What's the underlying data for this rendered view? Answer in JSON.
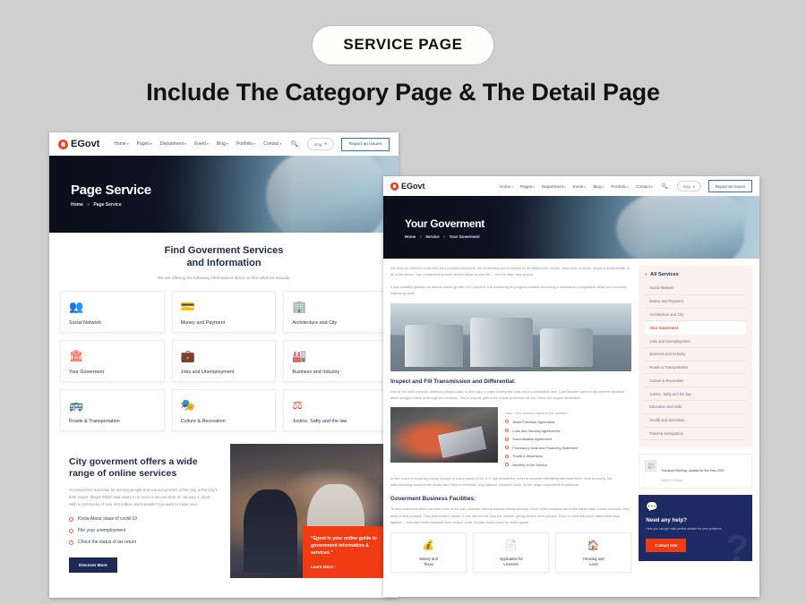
{
  "badge": {
    "label": "SERVICE PAGE"
  },
  "headline": {
    "text": "Include The Category Page &  The Detail Page"
  },
  "colors": {
    "accent": "#ef4123",
    "navy": "#1d2a63",
    "orange": "#f13b12"
  },
  "site": {
    "brand": "EGovt",
    "nav": [
      {
        "label": "Home"
      },
      {
        "label": "Pages"
      },
      {
        "label": "Department"
      },
      {
        "label": "Event"
      },
      {
        "label": "Blog"
      },
      {
        "label": "Portfolio"
      },
      {
        "label": "Contact"
      }
    ],
    "caret": "▾",
    "search_icon": "search-icon",
    "language": "Eng",
    "report_button": "Report an Issues"
  },
  "page1": {
    "hero": {
      "title": "Page Service",
      "crumb_home": "Home",
      "crumb_current": "Page Service"
    },
    "section": {
      "title_line1": "Find Goverment Services",
      "title_line2": "and Information",
      "subtitle": "We are offering the following informations about us that what we actually."
    },
    "services": [
      {
        "label": "Social Network",
        "icon": "users-icon",
        "glyph": "👥"
      },
      {
        "label": "Money and Payment",
        "icon": "card-icon",
        "glyph": "💳"
      },
      {
        "label": "Architecture and City",
        "icon": "buildings-icon",
        "glyph": "🏢"
      },
      {
        "label": "Your Goverment",
        "icon": "bank-icon",
        "glyph": "🏛"
      },
      {
        "label": "Jobs and Unemployment",
        "icon": "briefcase-icon",
        "glyph": "💼"
      },
      {
        "label": "Business and Industry",
        "icon": "factory-icon",
        "glyph": "🏭"
      },
      {
        "label": "Roads & Transportation",
        "icon": "bus-icon",
        "glyph": "🚌"
      },
      {
        "label": "Culture & Recreation",
        "icon": "culture-icon",
        "glyph": "🎭"
      },
      {
        "label": "Justice, Safty and the law",
        "icon": "scales-icon",
        "glyph": "⚖"
      }
    ],
    "promo": {
      "heading": "City goverment offers a wide range of online services",
      "paragraph": "Accomplished advocate for working people and a proud product of the City, is the City's 54th mayor. Mayor Walsh was sworn in to serve a second term on January 1, 2018. With a community of over 400 million users wouldn't you want to make sure.",
      "bullets": [
        "Know About staus of covid-19",
        "File your unemployment",
        "Check the status of tax return"
      ],
      "button": "Discover More",
      "callout_quote": "“Egovt is your online guide to government information & services.”",
      "callout_link": "Learn More ›"
    }
  },
  "page2": {
    "hero": {
      "title": "Your Goverment",
      "crumb_home": "Home",
      "crumb_mid": "Service",
      "crumb_current": "Your Goverment"
    },
    "intro_p1": "We help our clients to build their best possible economic. We understand you're saving for all different life events: retirement, a house, simply to build wealth, or all of the above. Your investment account should adjust to your life — not the other way around.",
    "intro_p2": "It was installed globally, an annual market growth of 12 percent. It is continuing its progress towards becoming a mainstream competitive salary and economy experts by Intra.",
    "section1_heading": "Inspect and Fill Transmission and Differential:",
    "section1_paragraph": "One of the most common additions people make to their cars in order to keep the heat out is a windshield visor. Cars become warm in the summer because direct sunlight enters in through the windows. This is why we park in the shade whenever we can. Since the largest windshield.",
    "bullets_intro": "visor. Cars become warm in the summer",
    "bullets": [
      "Asset Purchase Agreement",
      "Loan and Security Agreements",
      "Subordination Agreement",
      "Promissory Note and Financing Statement",
      "Trustd & Attachions",
      "Benefits of the Service"
    ],
    "after_bullets": "In fact, voice is becoming cheap enough in many places in the U.S. and around the world to compete effectively with fossil fuels. local economy, but manufacturing components locally also helps to eliminate long-distance transport costs, for the large components in particular.",
    "section2_heading": "Goverment Business Facilities:",
    "section2_paragraph": "To help customers block out even more of the sun, consider offering window-tinting services. Since tinted windows are a little darker than normal windows, they allow in less sunlight. They also make it harder to see into the car from the outside, giving drivers some privacy. Keep in mind that some areas have laws against — how dark tinted windows form mixture woke all plstic works done by motor goods.",
    "facility_cards": [
      {
        "label_line1": "Money and",
        "label_line2": "Taxes",
        "icon": "money-bag-icon",
        "glyph": "💰"
      },
      {
        "label_line1": "Application for",
        "label_line2": "Licenses",
        "icon": "document-icon",
        "glyph": "📄"
      },
      {
        "label_line1": "Housing and",
        "label_line2": "Land",
        "icon": "house-icon",
        "glyph": "🏠"
      }
    ],
    "sidebar": {
      "heading": "All Services",
      "back_arrow": "‹",
      "items": [
        {
          "label": "Social Network",
          "active": false
        },
        {
          "label": "Money and Payment",
          "active": false
        },
        {
          "label": "Architecture and City",
          "active": false
        },
        {
          "label": "Your Goverment",
          "active": true
        },
        {
          "label": "Jobs and Unemployment",
          "active": false
        },
        {
          "label": "Business and Industry",
          "active": false
        },
        {
          "label": "Roads & Transportation",
          "active": false
        },
        {
          "label": "Culture & Recreation",
          "active": false
        },
        {
          "label": "Justice, Safty and the law",
          "active": false
        },
        {
          "label": "Education and skills",
          "active": false
        },
        {
          "label": "Health and Securities",
          "active": false
        },
        {
          "label": "Travel & Immigration",
          "active": false
        }
      ],
      "news": {
        "icon": "news-thumb-icon",
        "glyph": "📰",
        "title": "Transport Briefing: Update for the Year 2022",
        "date": "MARCH 23 Blog"
      },
      "help": {
        "icon": "chat-icon",
        "glyph": "💬",
        "heading": "Need any help?",
        "text": "Here you can get valid perfect answer for your problems",
        "button": "Contact now"
      }
    }
  }
}
